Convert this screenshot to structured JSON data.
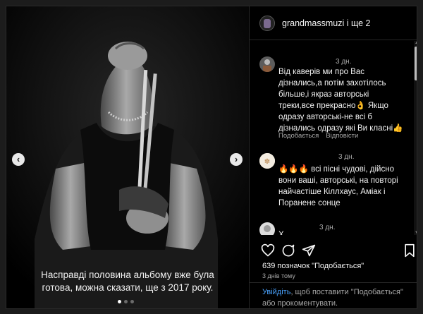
{
  "post": {
    "caption": "Насправді половина альбому вже була готова, можна сказати, ще з 2017 року.",
    "carousel_dots": 3,
    "active_dot": 1,
    "prev_glyph": "‹",
    "next_glyph": "›"
  },
  "header": {
    "username": "grandmassmuzi і ще 2"
  },
  "comments": [
    {
      "time": "3 дн.",
      "text": "Від каверів ми про Вас дізнались,а потім захотілось більше,і якраз авторські треки,все прекрасно👌 Якщо одразу авторські-не всі б дізнались одразу які Ви класні👍",
      "like_label": "Подобається",
      "reply_label": "Відповісти"
    },
    {
      "time": "3 дн.",
      "text": "🔥🔥🔥 всі пісні чудові, дійсно вони ваші, авторські, на повторі найчастіше Кіллхаус, Аміак і Поранене сонце",
      "like_label": "Подобається",
      "reply_label": "Відповісти"
    },
    {
      "time": "3 дн.",
      "text": "Х...",
      "like_label": "",
      "reply_label": ""
    }
  ],
  "actions": {
    "like_icon": "heart-icon",
    "comment_icon": "comment-icon",
    "share_icon": "share-icon",
    "save_icon": "bookmark-icon"
  },
  "stats": {
    "likes": "639 позначок \"Подобається\"",
    "time_ago": "3 днів тому"
  },
  "login_prompt": {
    "link": "Увійдіть",
    "rest": ", щоб поставити \"Подобається\" або прокоментувати."
  },
  "colors": {
    "link": "#4aa3ff",
    "background": "#000000"
  }
}
